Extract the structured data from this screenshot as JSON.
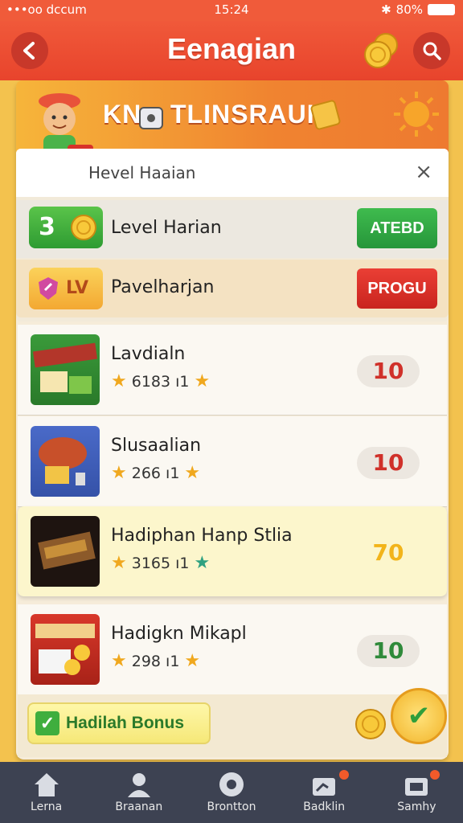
{
  "status": {
    "carrier": "•••oo dccum",
    "time": "15:24",
    "battery": "80%"
  },
  "appbar": {
    "title": "Eenagian"
  },
  "banner": {
    "title_left": "KN",
    "title_right": "TLINSRAUI"
  },
  "dialog": {
    "title": "Hevel Haaian",
    "close": "×"
  },
  "daily_rows": [
    {
      "badge": "3",
      "label": "Level Harian",
      "button": "ATEBD"
    },
    {
      "badge": "LV",
      "label": "Pavelharjan",
      "button": "PROGU"
    }
  ],
  "items": [
    {
      "name": "Lavdialn",
      "meta": "6183 ı1",
      "value": "10",
      "value_color": "#d0312a"
    },
    {
      "name": "Slusaalian",
      "meta": "266 ı1",
      "value": "10",
      "value_color": "#d0312a"
    },
    {
      "name": "Hadiphan Hanp Stlia",
      "meta": "3165 ı1",
      "value": "70",
      "value_color": "#f2b41a"
    },
    {
      "name": "Hadigkn Mikapl",
      "meta": "298 ı1",
      "value": "10",
      "value_color": "#2f8a3a"
    }
  ],
  "bonus": {
    "label": "Hadilah Bonus"
  },
  "tabs": [
    {
      "label": "Lerna",
      "icon": "home-icon"
    },
    {
      "label": "Braanan",
      "icon": "profile-icon"
    },
    {
      "label": "Brontton",
      "icon": "controller-icon"
    },
    {
      "label": "Badklin",
      "icon": "gift-icon"
    },
    {
      "label": "Samhy",
      "icon": "settings-icon"
    }
  ]
}
